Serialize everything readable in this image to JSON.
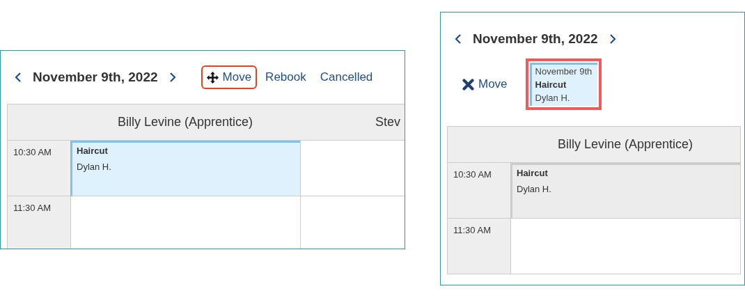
{
  "panels": [
    {
      "date": "November 9th, 2022",
      "actions": [
        {
          "kind": "move",
          "label": "Move",
          "highlighted": true
        },
        {
          "kind": "link",
          "label": "Rebook",
          "highlighted": false
        },
        {
          "kind": "link",
          "label": "Cancelled",
          "highlighted": false
        }
      ],
      "columns": [
        "Billy Levine (Apprentice)",
        "Stev"
      ],
      "rows": [
        {
          "time": "10:30 AM",
          "cells": [
            {
              "kind": "appointment",
              "service": "Haircut",
              "client": "Dylan H.",
              "moving": false
            },
            {
              "kind": "empty"
            }
          ]
        },
        {
          "time": "11:30 AM",
          "cells": [
            {
              "kind": "empty"
            },
            {
              "kind": "empty"
            }
          ]
        }
      ]
    },
    {
      "date": "November 9th, 2022",
      "actions": [
        {
          "kind": "cancel-move",
          "label": "Move",
          "highlighted": false
        }
      ],
      "drag_card": {
        "date": "November 9th",
        "service": "Haircut",
        "client": "Dylan H.",
        "highlighted": true
      },
      "columns": [
        "Billy Levine (Apprentice)"
      ],
      "rows": [
        {
          "time": "10:30 AM",
          "cells": [
            {
              "kind": "appointment",
              "service": "Haircut",
              "client": "Dylan H.",
              "moving": true
            }
          ]
        },
        {
          "time": "11:30 AM",
          "cells": [
            {
              "kind": "empty"
            }
          ]
        }
      ]
    }
  ]
}
